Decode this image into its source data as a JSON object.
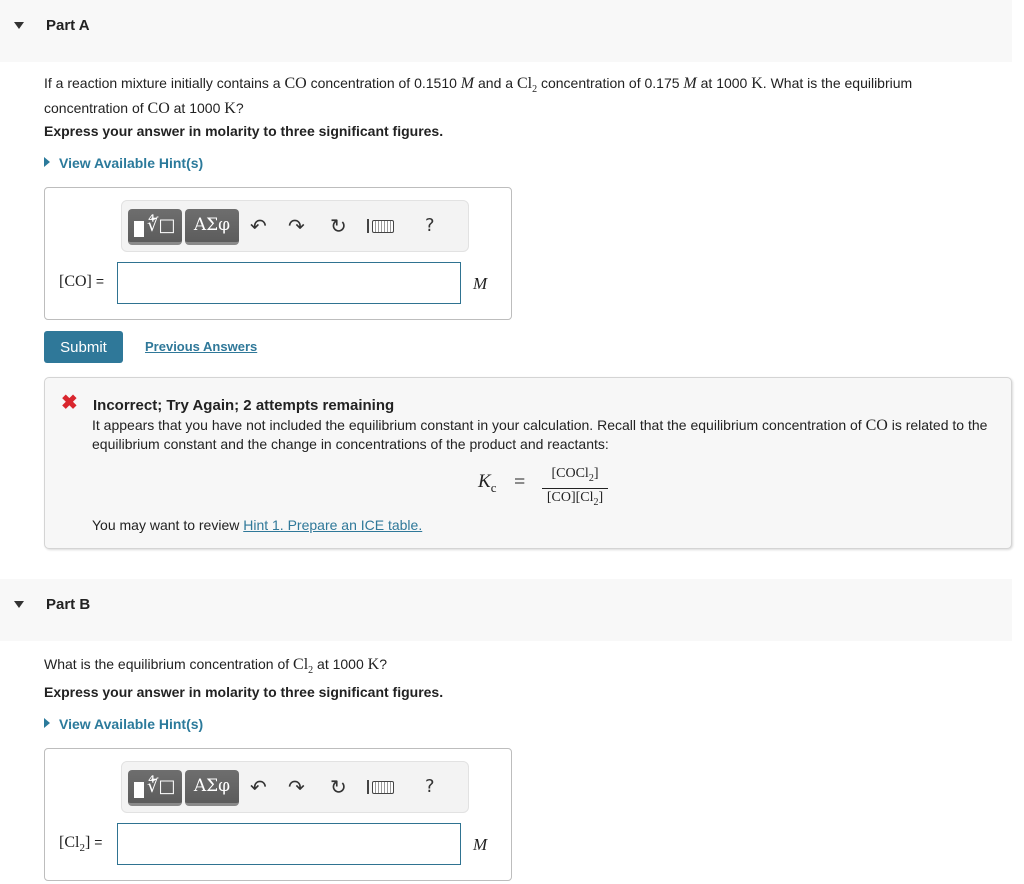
{
  "partA": {
    "title": "Part A",
    "question_pre": "If a reaction mixture initially contains a ",
    "co": "CO",
    "q_mid1": " concentration of 0.1510 ",
    "M": "M",
    "q_mid2": " and a ",
    "cl": "Cl",
    "two": "2",
    "q_mid3": "  concentration of 0.175 ",
    "q_mid4": " at 1000 ",
    "K": "K",
    "q_end1": ". What is the equilibrium",
    "q_line2_pre": "concentration of ",
    "q_line2_mid": " at 1000 ",
    "q_line2_end": "?",
    "instruction": "Express your answer in molarity to three significant figures.",
    "hints_link": "View Available Hint(s)",
    "answer_label": "[CO]",
    "equals": "=",
    "answer_value": "",
    "unit": "M",
    "submit": "Submit",
    "previous_answers": "Previous Answers",
    "feedback": {
      "status": "Incorrect; Try Again; 2 attempts remaining",
      "body_1": "It appears that you have not included the equilibrium constant in your calculation. Recall that the equilibrium concentration of ",
      "body_co": "CO",
      "body_2": " is related to the equilibrium constant and the change in concentrations of the product and reactants:",
      "formula": {
        "lhs": "K",
        "lhs_sub": "c",
        "eq": "=",
        "numerator_pre": "[COCl",
        "numerator_sub": "2",
        "numerator_post": "]",
        "denominator_pre": "[CO][Cl",
        "denominator_sub": "2",
        "denominator_post": "]"
      },
      "review_text": "You may want to review ",
      "review_link": "Hint 1. Prepare an ICE table.",
      "error_color": "#d9262e"
    }
  },
  "partB": {
    "title": "Part B",
    "question_pre": "What is the equilibrium concentration of ",
    "cl": "Cl",
    "two": "2",
    "q_mid": "  at 1000 ",
    "K": "K",
    "q_end": "?",
    "instruction": "Express your answer in molarity to three significant figures.",
    "hints_link": "View Available Hint(s)",
    "answer_label_pre": "[Cl",
    "answer_label_sub": "2",
    "answer_label_post": "]",
    "equals": "=",
    "answer_value": "",
    "unit": "M"
  },
  "toolbar": {
    "templates_icon": "√",
    "greek_label": "ΑΣφ",
    "undo_icon": "↶",
    "redo_icon": "↷",
    "reset_icon": "↻",
    "help_label": "?"
  },
  "colors": {
    "accent": "#2f7899",
    "link": "#2b7a9b",
    "header_bg": "#f8f8f8"
  }
}
